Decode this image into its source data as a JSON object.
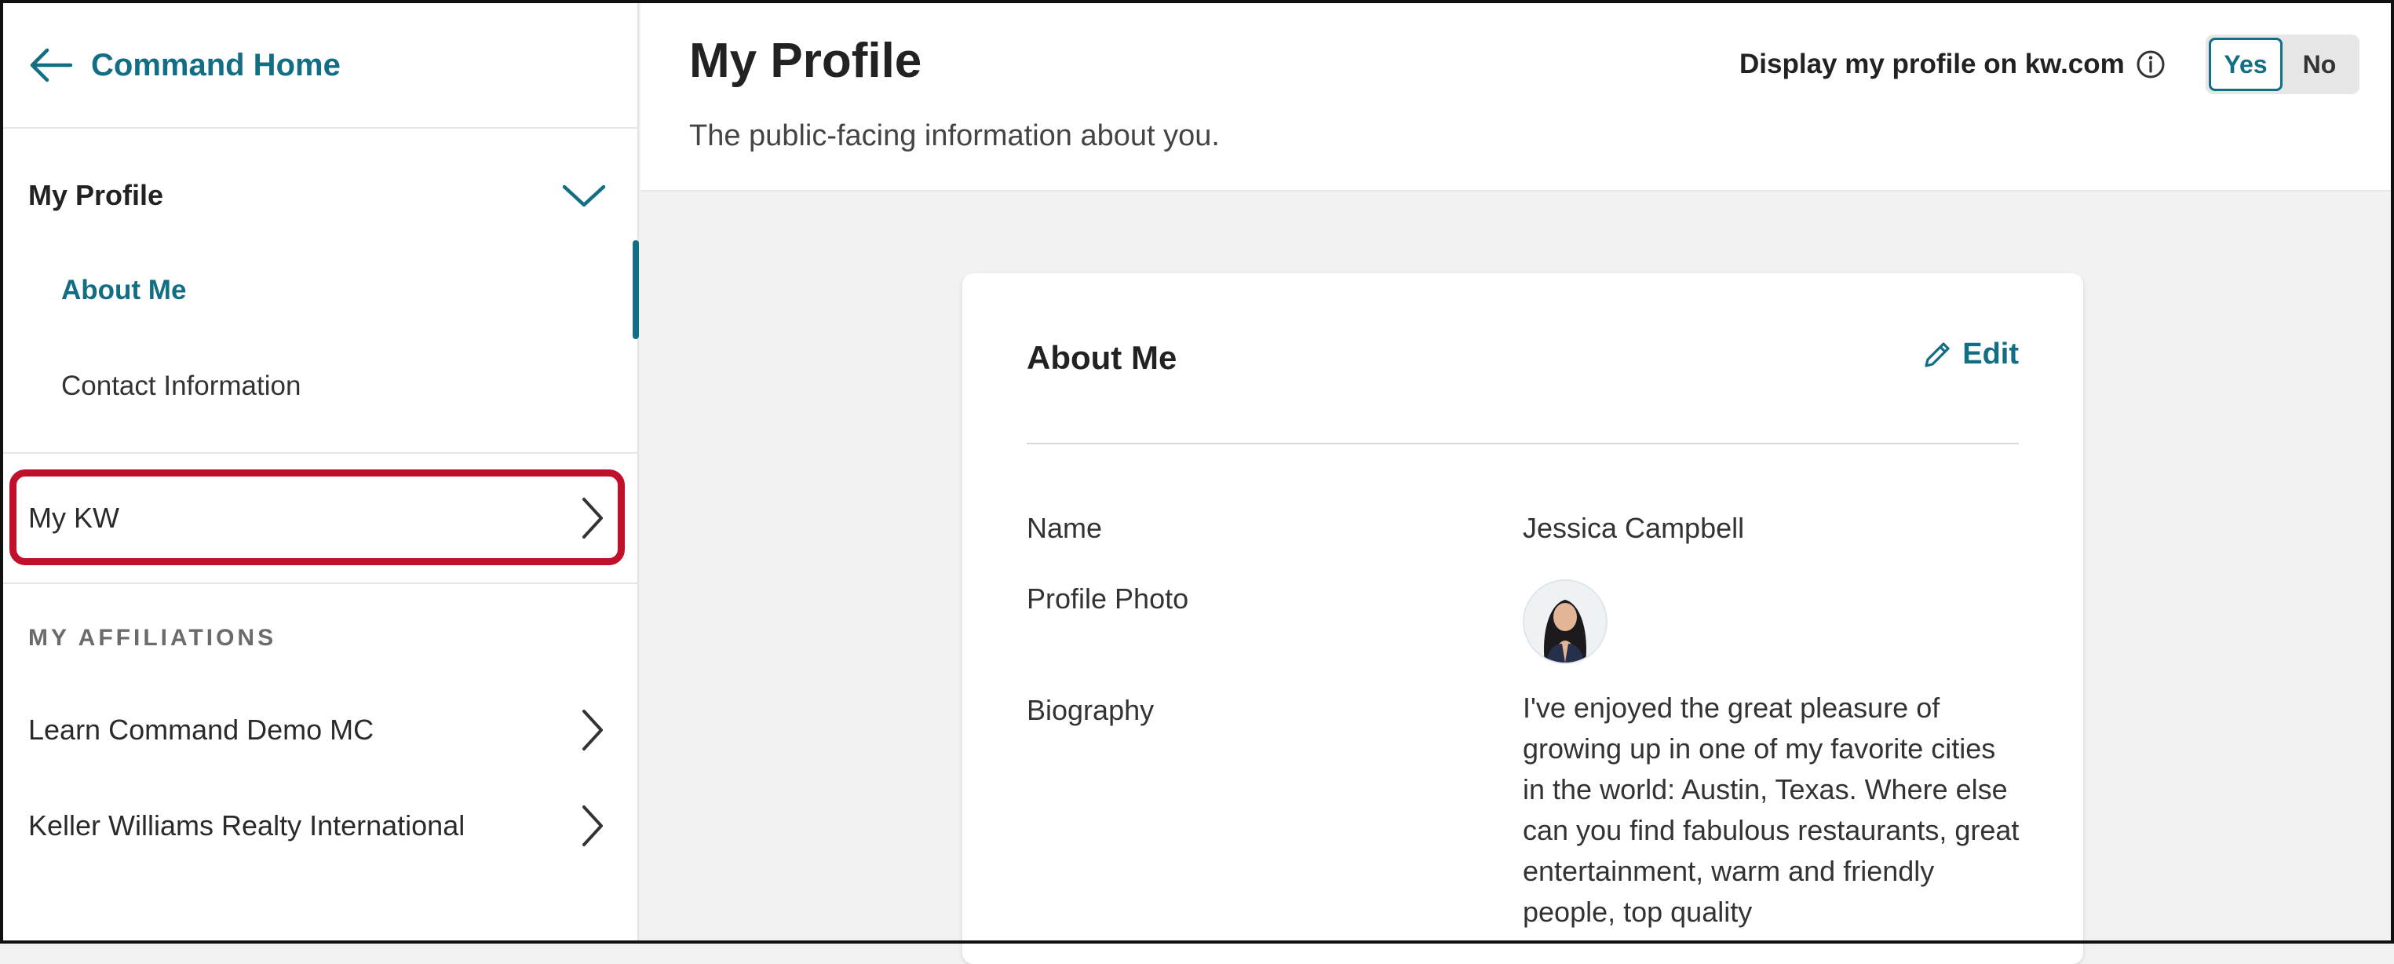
{
  "sidebar": {
    "back_label": "Command Home",
    "section_title": "My Profile",
    "items": [
      {
        "label": "About Me"
      },
      {
        "label": "Contact Information"
      }
    ],
    "my_kw_label": "My KW",
    "affiliations_title": "MY AFFILIATIONS",
    "affiliations": [
      {
        "label": "Learn Command Demo MC"
      },
      {
        "label": "Keller Williams Realty International"
      }
    ]
  },
  "header": {
    "title": "My Profile",
    "subtitle": "The public-facing information about you.",
    "display_label": "Display my profile on kw.com",
    "toggle": {
      "yes": "Yes",
      "no": "No",
      "selected": "Yes"
    }
  },
  "card": {
    "title": "About Me",
    "edit_label": "Edit",
    "fields": {
      "name_label": "Name",
      "name_value": "Jessica Campbell",
      "photo_label": "Profile Photo",
      "bio_label": "Biography",
      "bio_value": "I've enjoyed the great pleasure of growing up in one of my favorite cities in the world: Austin, Texas. Where else can you find fabulous restaurants, great entertainment, warm and friendly people, top quality"
    }
  },
  "colors": {
    "accent": "#126e84",
    "highlight": "#c0102c"
  }
}
